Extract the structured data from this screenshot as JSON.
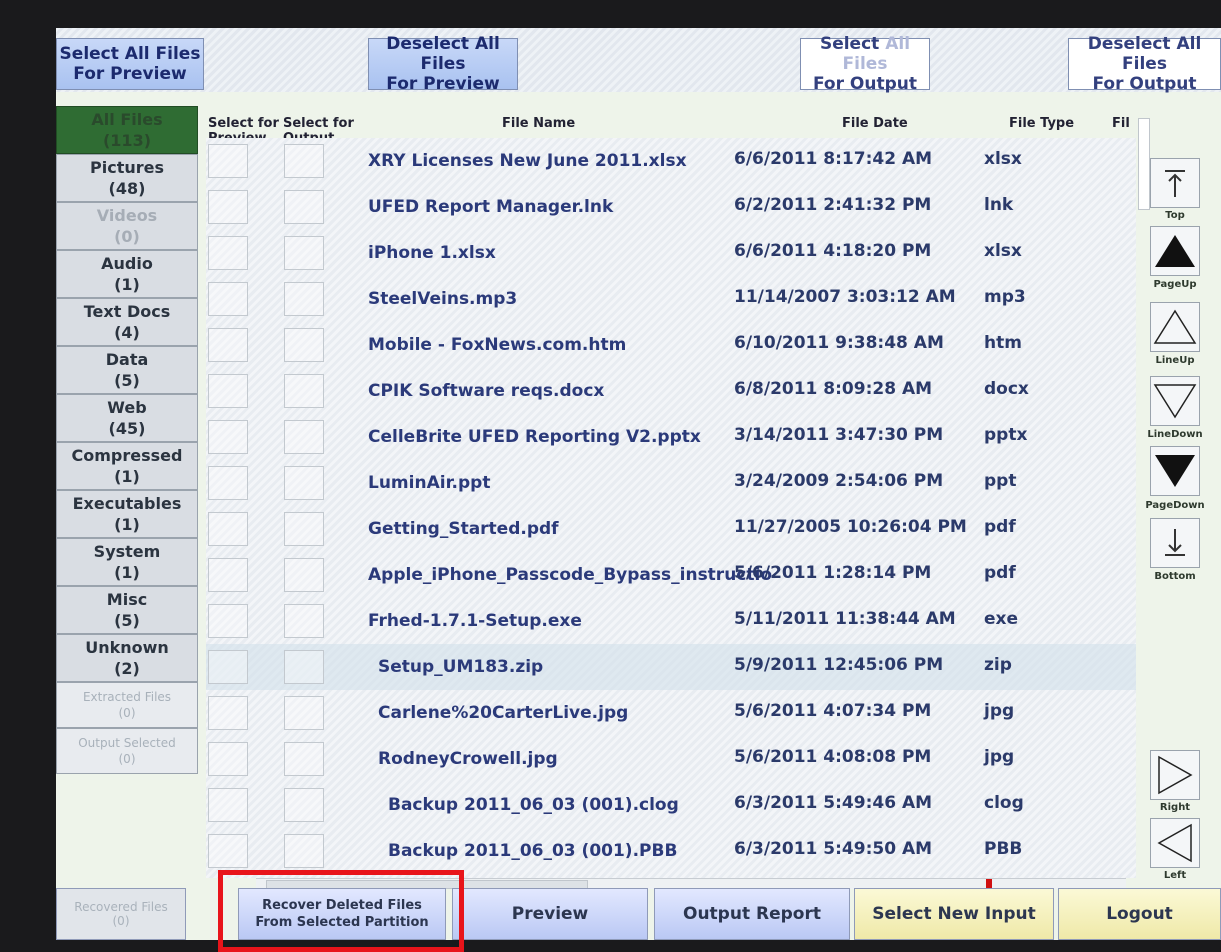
{
  "top_buttons": {
    "select_all_preview": [
      "Select All Files",
      "For Preview"
    ],
    "deselect_all_preview": [
      "Deselect All Files",
      "For Preview"
    ],
    "select_all_output": [
      "Select",
      "All Files",
      "For Output"
    ],
    "deselect_all_output": [
      "Deselect All Files",
      "For Output"
    ]
  },
  "categories": [
    {
      "label": "All Files",
      "count": "(113)"
    },
    {
      "label": "Pictures",
      "count": "(48)"
    },
    {
      "label": "Videos",
      "count": "(0)"
    },
    {
      "label": "Audio",
      "count": "(1)"
    },
    {
      "label": "Text Docs",
      "count": "(4)"
    },
    {
      "label": "Data",
      "count": "(5)"
    },
    {
      "label": "Web",
      "count": "(45)"
    },
    {
      "label": "Compressed",
      "count": "(1)"
    },
    {
      "label": "Executables",
      "count": "(1)"
    },
    {
      "label": "System",
      "count": "(1)"
    },
    {
      "label": "Misc",
      "count": "(5)"
    },
    {
      "label": "Unknown",
      "count": "(2)"
    },
    {
      "label": "Extracted Files",
      "count": "(0)"
    },
    {
      "label": "Output Selected",
      "count": "(0)"
    }
  ],
  "columns": {
    "select_preview": [
      "Select for",
      "Preview"
    ],
    "select_output": [
      "Select for",
      "Output"
    ],
    "file_name": "File Name",
    "file_date": "File Date",
    "file_type": "File Type",
    "file_size": "Fil"
  },
  "files": [
    {
      "name": "XRY Licenses New June 2011.xlsx",
      "date": "6/6/2011 8:17:42 AM",
      "type": "xlsx"
    },
    {
      "name": "UFED Report Manager.lnk",
      "date": "6/2/2011 2:41:32 PM",
      "type": "lnk"
    },
    {
      "name": "iPhone 1.xlsx",
      "date": "6/6/2011 4:18:20 PM",
      "type": "xlsx"
    },
    {
      "name": "SteelVeins.mp3",
      "date": "11/14/2007 3:03:12 AM",
      "type": "mp3"
    },
    {
      "name": "Mobile - FoxNews.com.htm",
      "date": "6/10/2011 9:38:48 AM",
      "type": "htm"
    },
    {
      "name": "CPIK Software reqs.docx",
      "date": "6/8/2011 8:09:28 AM",
      "type": "docx"
    },
    {
      "name": "CelleBrite UFED Reporting V2.pptx",
      "date": "3/14/2011 3:47:30 PM",
      "type": "pptx"
    },
    {
      "name": "LuminAir.ppt",
      "date": "3/24/2009 2:54:06 PM",
      "type": "ppt"
    },
    {
      "name": "Getting_Started.pdf",
      "date": "11/27/2005 10:26:04 PM",
      "type": "pdf"
    },
    {
      "name": "Apple_iPhone_Passcode_Bypass_instructio",
      "date": "5/6/2011 1:28:14 PM",
      "type": "pdf"
    },
    {
      "name": "Frhed-1.7.1-Setup.exe",
      "date": "5/11/2011 11:38:44 AM",
      "type": "exe"
    },
    {
      "name": "Setup_UM183.zip",
      "date": "5/9/2011 12:45:06 PM",
      "type": "zip"
    },
    {
      "name": "Carlene%20CarterLive.jpg",
      "date": "5/6/2011 4:07:34 PM",
      "type": "jpg"
    },
    {
      "name": "RodneyCrowell.jpg",
      "date": "5/6/2011 4:08:08 PM",
      "type": "jpg"
    },
    {
      "name": "Backup 2011_06_03 (001).clog",
      "date": "6/3/2011 5:49:46 AM",
      "type": "clog"
    },
    {
      "name": "Backup 2011_06_03 (001).PBB",
      "date": "6/3/2011 5:49:50 AM",
      "type": "PBB"
    }
  ],
  "nav": {
    "top": "Top",
    "page_up": "PageUp",
    "line_up": "LineUp",
    "line_down": "LineDown",
    "page_down": "PageDown",
    "bottom": "Bottom",
    "right": "Right",
    "left": "Left"
  },
  "bottom_buttons": {
    "recovered_files": [
      "Recovered Files",
      "(0)"
    ],
    "recover_deleted": [
      "Recover Deleted Files",
      "From Selected Partition"
    ],
    "preview": "Preview",
    "output_report": "Output Report",
    "select_new_input": "Select New Input",
    "logout": "Logout"
  },
  "colors": {
    "highlight_box": "#e8141a",
    "active_category": "#2f6c33",
    "file_text": "#2b3a7a"
  }
}
